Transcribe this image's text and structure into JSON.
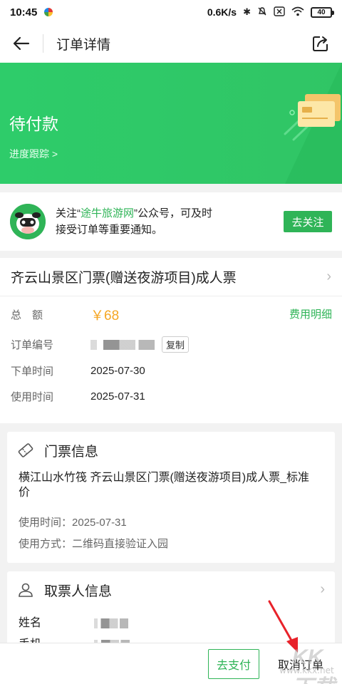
{
  "status_bar": {
    "time": "10:45",
    "network_speed": "0.6K/s",
    "battery": "40",
    "icons": [
      "bluetooth-icon",
      "mute-icon",
      "sim-off-icon",
      "wifi-icon",
      "battery-icon"
    ]
  },
  "nav": {
    "title": "订单详情",
    "back_icon": "arrow-left-icon",
    "share_icon": "share-icon"
  },
  "order_status": {
    "label": "待付款",
    "progress_link": "进度跟踪 >",
    "accent_color": "#30c565"
  },
  "follow_card": {
    "text_before": "关注“",
    "account_name": "途牛旅游网",
    "text_after": "”公众号，可及时接受订单等重要通知。",
    "button_label": "去关注"
  },
  "product": {
    "title": "齐云山景区门票(赠送夜游项目)成人票",
    "total_label": "总　额",
    "total_value": "￥68",
    "fee_detail_link": "费用明细",
    "order_no_label": "订单编号",
    "copy_label": "复制",
    "order_time_label": "下单时间",
    "order_time_value": "2025-07-30",
    "use_time_label": "使用时间",
    "use_time_value": "2025-07-31"
  },
  "ticket_info": {
    "title": "门票信息",
    "name": "横江山水竹筏 齐云山景区门票(赠送夜游项目)成人票_标准价",
    "use_time_label": "使用时间：",
    "use_time_value": "2025-07-31",
    "use_method_label": "使用方式：",
    "use_method_value": "二维码直接验证入园"
  },
  "picker_info": {
    "title": "取票人信息",
    "name_label": "姓名",
    "phone_label": "手机"
  },
  "bottom_bar": {
    "pay_button": "去支付",
    "cancel_button": "取消订单"
  },
  "watermark": {
    "text": "KK下载",
    "url": "www.kkx.net"
  }
}
